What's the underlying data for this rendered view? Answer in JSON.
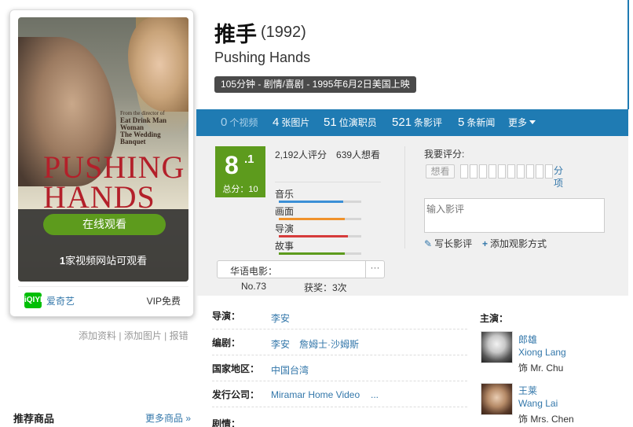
{
  "movie": {
    "title_cn": "推手",
    "year": "(1992)",
    "title_en": "Pushing Hands",
    "meta": "105分钟 - 剧情/喜剧 - 1995年6月2日美国上映"
  },
  "poster": {
    "big_title": "PUSHING HANDS",
    "credit_small": "From the director of",
    "credit_film1": "Eat Drink Man Woman",
    "credit_film2": "The Wedding Banquet",
    "watch_button": "在线观看",
    "watch_count": "1",
    "watch_sites_text": "家视频网站可观看",
    "provider_icon": "iQIYI",
    "provider_name": "爱奇艺",
    "provider_price": "VIP免费"
  },
  "left_links": {
    "add_info": "添加资料",
    "add_images": "添加图片",
    "report": "报错",
    "separator": " | "
  },
  "recommend": {
    "title": "推荐商品",
    "more": "更多商品 »"
  },
  "tabs": [
    {
      "num": "0",
      "label": "个视频"
    },
    {
      "num": "4",
      "label": "张图片"
    },
    {
      "num": "51",
      "label": "位演职员"
    },
    {
      "num": "521",
      "label": "条影评"
    },
    {
      "num": "5",
      "label": "条新闻"
    }
  ],
  "tab_more": "更多",
  "rating": {
    "score_main": "8",
    "score_sup": ".1",
    "score_total": "总分：10",
    "votes": "2,192人评分",
    "want": "639人想看",
    "dimensions": [
      {
        "label": "音乐",
        "color": "#3b8fd6",
        "value": 0.78
      },
      {
        "label": "画面",
        "color": "#f0922b",
        "value": 0.8
      },
      {
        "label": "导演",
        "color": "#d63b3b",
        "value": 0.84
      },
      {
        "label": "故事",
        "color": "#5d9b1d",
        "value": 0.8
      }
    ],
    "my_rating_label": "我要评分:",
    "want_button": "想看",
    "score_unit": "分项",
    "review_placeholder": "输入影评",
    "write_review": "写长影评",
    "add_watch": "添加观影方式",
    "rank_label": "华语电影：",
    "rank_dots": "···",
    "rank_number": "No.73",
    "awards": "获奖：3次",
    "accent_green": "#5d9b1d",
    "tab_blue": "#1f7bb3"
  },
  "info": {
    "director_label": "导演：",
    "director": "李安",
    "writer_label": "编剧：",
    "writer1": "李安",
    "writer2": "詹姆士·沙姆斯",
    "region_label": "国家地区：",
    "region": "中国台湾",
    "distributor_label": "发行公司：",
    "distributor": "Miramar Home Video",
    "distributor_more": "...",
    "plot_label": "剧情："
  },
  "cast": {
    "title": "主演：",
    "members": [
      {
        "name_cn": "郎雄",
        "name_en": "Xiong Lang",
        "role": "饰 Mr. Chu"
      },
      {
        "name_cn": "王莱",
        "name_en": "Wang Lai",
        "role": "饰 Mrs. Chen"
      }
    ]
  }
}
